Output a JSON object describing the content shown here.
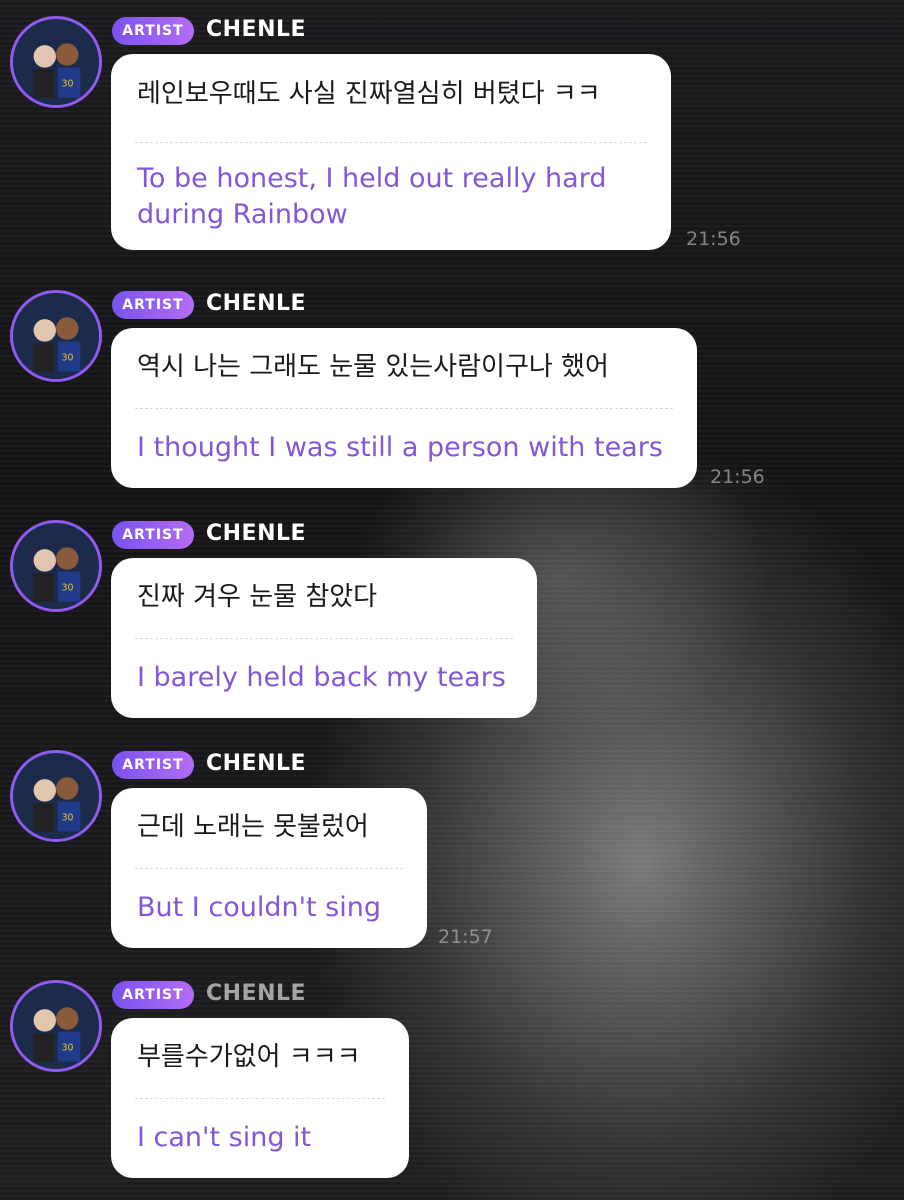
{
  "background": {
    "accent": "#8e5cf0",
    "badge_gradient": [
      "#7a52f0",
      "#b36df5"
    ],
    "translation_color": "#8457d8"
  },
  "messages": [
    {
      "badge": "ARTIST",
      "name": "CHENLE",
      "korean": "레인보우때도 사실 진짜열심히 버텼다 ㅋㅋ",
      "english": "To be honest, I held out really hard during Rainbow",
      "time": "21:56"
    },
    {
      "badge": "ARTIST",
      "name": "CHENLE",
      "korean": "역시 나는 그래도 눈물 있는사람이구나 했어",
      "english": "I thought I was still a person with tears",
      "time": "21:56"
    },
    {
      "badge": "ARTIST",
      "name": "CHENLE",
      "korean": "진짜 겨우 눈물 참았다",
      "english": "I barely held back my tears",
      "time": ""
    },
    {
      "badge": "ARTIST",
      "name": "CHENLE",
      "korean": "근데 노래는 못불렀어",
      "english": "But I couldn't sing",
      "time": "21:57"
    },
    {
      "badge": "ARTIST",
      "name": "CHENLE",
      "korean": "부를수가없어 ㅋㅋㅋ",
      "english": "I can't sing it",
      "time": ""
    }
  ]
}
